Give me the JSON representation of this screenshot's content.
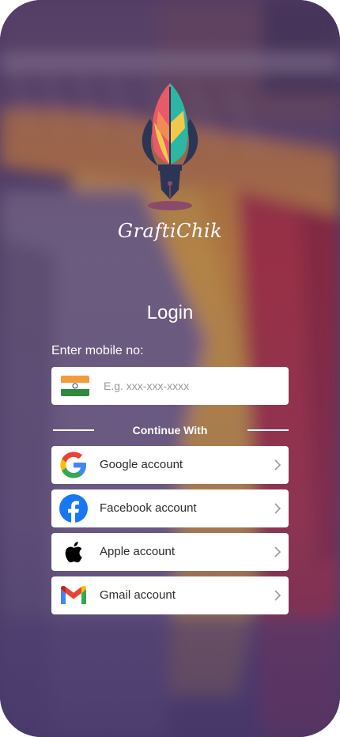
{
  "brand": {
    "name": "GraftiChik",
    "logo_icon": "quill-pen-logo",
    "logo_colors": [
      "#e85a67",
      "#f2c84b",
      "#2bb7a3",
      "#2d3557"
    ]
  },
  "background": {
    "description_icon": "clothes-rack-photo",
    "colors": [
      "#e29a3a",
      "#f4b43a",
      "#c9363a",
      "#7a6a86"
    ]
  },
  "login": {
    "title": "Login",
    "mobile_label": "Enter mobile no:",
    "mobile_input": {
      "value": "",
      "placeholder": "E.g. xxx-xxx-xxxx",
      "country_flag_icon": "india-flag-icon"
    },
    "divider_text": "Continue With"
  },
  "social_buttons": [
    {
      "label": "Google account",
      "icon": "google-icon"
    },
    {
      "label": "Facebook account",
      "icon": "facebook-icon"
    },
    {
      "label": "Apple account",
      "icon": "apple-icon"
    },
    {
      "label": "Gmail account",
      "icon": "gmail-icon"
    }
  ]
}
